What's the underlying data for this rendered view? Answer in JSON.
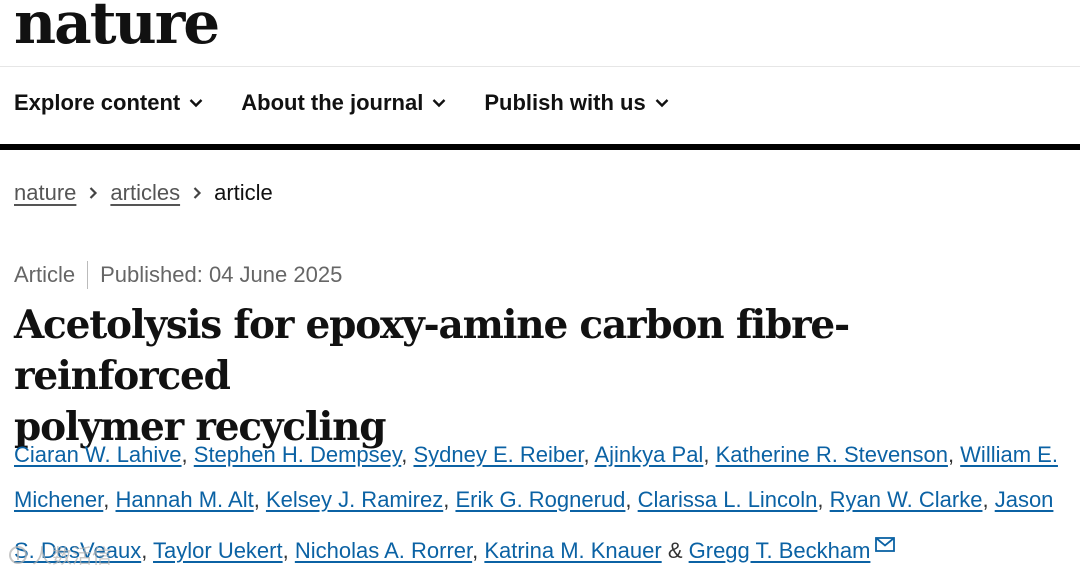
{
  "header": {
    "logo": "nature",
    "nav": [
      {
        "label": "Explore content"
      },
      {
        "label": "About the journal"
      },
      {
        "label": "Publish with us"
      }
    ],
    "chevron_icon": "chevron-down-icon"
  },
  "breadcrumb": {
    "items": [
      "nature",
      "articles"
    ],
    "current": "article",
    "separator_icon": "chevron-right-icon"
  },
  "article": {
    "type": "Article",
    "published": "Published: 04 June 2025",
    "title_line1": "Acetolysis for epoxy-amine carbon fibre-reinforced",
    "title_line2": "polymer recycling",
    "authors": [
      "Ciaran W. Lahive",
      "Stephen H. Dempsey",
      "Sydney E. Reiber",
      "Ajinkya Pal",
      "Katherine R. Stevenson",
      "William E. Michener",
      "Hannah M. Alt",
      "Kelsey J. Ramirez",
      "Erik G. Rognerud",
      "Clarissa L. Lincoln",
      "Ryan W. Clarke",
      "Jason S. DesVeaux",
      "Taylor Uekert",
      "Nicholas A. Rorrer",
      "Katrina M. Knauer",
      "Gregg T. Beckham"
    ],
    "ampersand": "&",
    "corresponding_icon": "mail-icon"
  },
  "watermark": {
    "text": "人数活信"
  },
  "colors": {
    "link": "#0b62a4",
    "bar": "#000000"
  }
}
